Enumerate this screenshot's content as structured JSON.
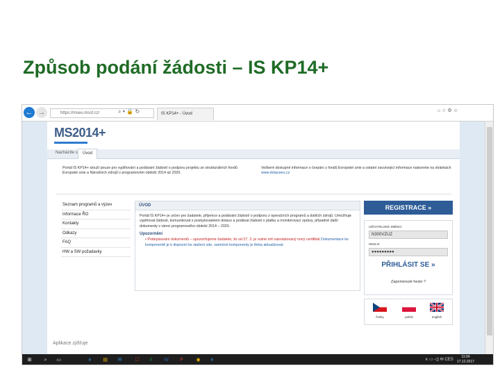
{
  "slide": {
    "title": "Způsob podání žádosti – IS KP14+"
  },
  "browser": {
    "back_glyph": "←",
    "forward_glyph": "→",
    "url": "https://mseu.mssf.cz/",
    "addr_tools": "⌕ ▾ 🔒 ↻",
    "tab_title": "IS KP14+ - Úvod",
    "right_tools": "⌂ ☆ ⚙ ☺"
  },
  "page": {
    "logo_text": "MS2014+",
    "breadcrumb": {
      "home": "Nacházíte se:",
      "active": "Úvod"
    },
    "notice_left": "Portál IS KP14+ slouží pouze pro vyplňování a podávání žádostí o podporu projektu ze strukturálních fondů Evropské unie a Národních zdrojů v programovém období 2014 až 2020.",
    "notice_right_text": "Veškeré dostupné informace o čerpání z fondů Evropské unie a ostatní související informace naleznete na stránkách",
    "notice_right_link": "www.dotaceeu.cz",
    "sidebar": [
      "Seznam programů a výzev",
      "Informace ŘO",
      "Kontakty",
      "Odkazy",
      "FAQ",
      "HW a SW požadavky"
    ],
    "main_panel": {
      "heading": "ÚVOD",
      "intro": "Portál IS KP14+ je určen pro žadatele, příjemce a podávání žádostí o podporu z operačních programů a dalších zdrojů. Umožňuje vyplňovat žádosti, komunikovat s poskytovatelem dotace a podávat žádosti o platbu a monitorovací zprávy, případně další dokumenty v rámci programového období 2014 – 2020.",
      "subheading": "Upozornění",
      "warning_red": "• Podepisování dokumentů – upozorňujeme žadatele, že od 27. 3. je nutné mít nainstalovaný nový certifikát",
      "warning_blue": "Dokumentace ke komponentě je k dispozici ke stažení zde, samotné komponenty je třeba aktualizovat."
    },
    "register_button": "REGISTRACE »",
    "login": {
      "username_label": "UŽIVATELSKÉ JMÉNO:",
      "username_value": "N300VZUZ",
      "password_label": "HESLO:",
      "password_value": "●●●●●●●●●",
      "login_button": "PŘIHLÁSIT SE »",
      "forgot_link": "Zapomenuté heslo ?"
    },
    "languages": [
      "česky",
      "polski",
      "english"
    ],
    "status_text": "Aplikace zjišťuje"
  },
  "taskbar": {
    "icons": [
      "⊞",
      "⌕",
      "▭",
      "e",
      "▤",
      "✉",
      "☐",
      "X",
      "W",
      "P",
      "◉",
      "e"
    ],
    "icon_colors": [
      "#ffffff",
      "#dddddd",
      "#dddddd",
      "#2b8fe0",
      "#f0b400",
      "#2b8fe0",
      "#c0392b",
      "#1e7a3c",
      "#2b5faf",
      "#c0392b",
      "#f0b400",
      "#2b8fe0"
    ],
    "tray": "∧ ▭ ◁) ✉ CES",
    "time": "11:04",
    "date": "17.12.2017"
  }
}
